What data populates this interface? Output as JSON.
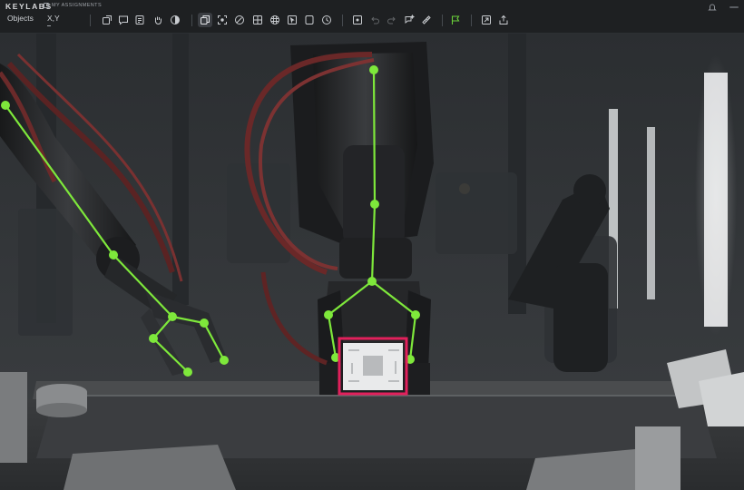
{
  "app": {
    "brand": "KEYLABS",
    "assignments_label": "MY ASSIGNMENTS"
  },
  "tabs": [
    {
      "label": "Objects"
    },
    {
      "label": "X,Y"
    }
  ],
  "toolbar": {
    "icons": [
      "rotate-image-icon",
      "comment-icon",
      "note-icon",
      "hand-tool-icon",
      "contrast-icon",
      "copy-icon",
      "fit-screen-icon",
      "brush-icon",
      "grid-icon",
      "pattern-icon",
      "select-icon",
      "frame-icon",
      "clock-icon",
      "crosshair-icon",
      "undo-icon",
      "redo-icon",
      "ai-assist-icon",
      "ruler-icon",
      "flag-icon",
      "export-icon",
      "share-icon"
    ],
    "active_icon": "copy-icon",
    "accent_color": "#6ad13a"
  },
  "annotation": {
    "skeleton_color": "#7ee83b",
    "bbox_color": "#e2205c"
  }
}
